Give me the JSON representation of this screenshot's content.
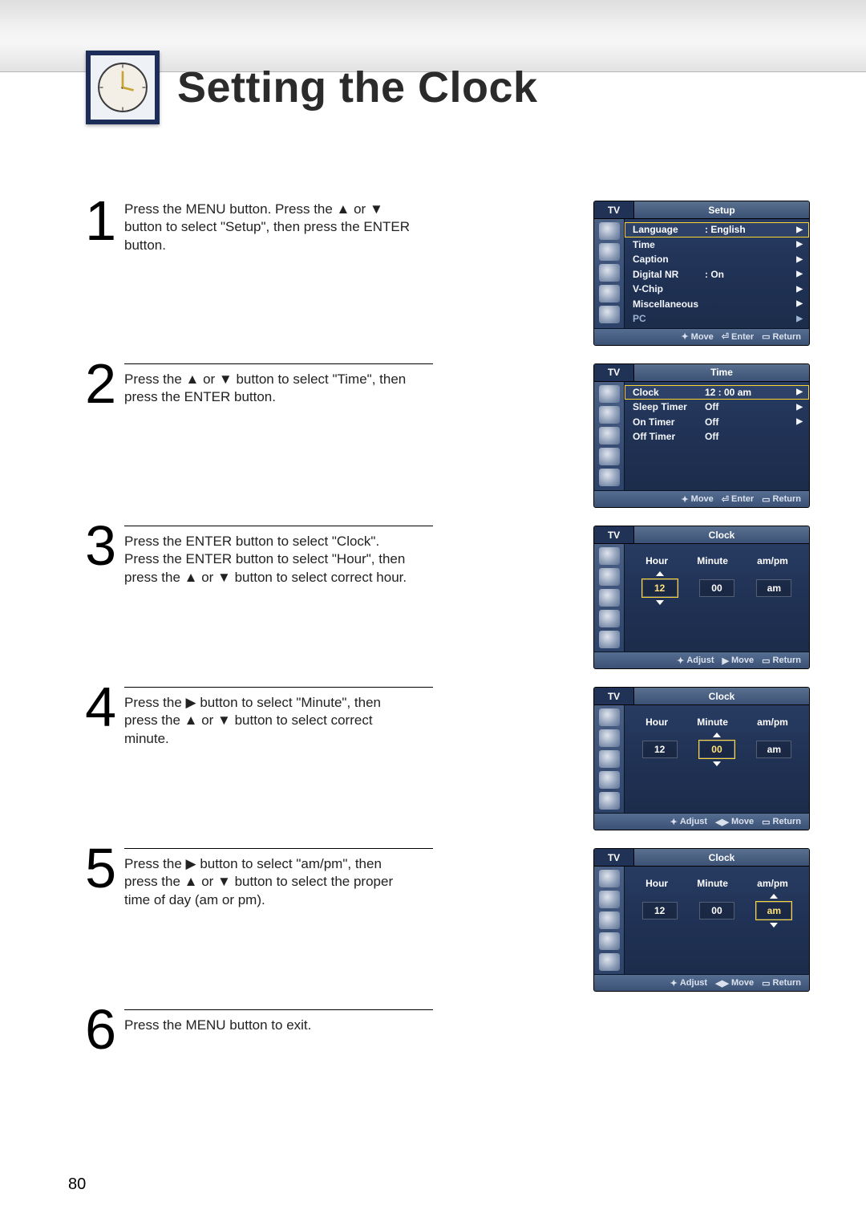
{
  "header": {
    "title": "Setting the Clock"
  },
  "page_number": "80",
  "glyph": {
    "up": "▲",
    "down": "▼",
    "right": "▶",
    "left": "◀",
    "updown": "◆",
    "leftright": "◀▶",
    "enter_box": "⏎",
    "return_box": "▭"
  },
  "steps": [
    {
      "num": "1",
      "text": "Press the MENU button. Press the ▲ or ▼ button to select \"Setup\", then press the ENTER button."
    },
    {
      "num": "2",
      "text": "Press the ▲ or ▼ button to select \"Time\", then press the ENTER button."
    },
    {
      "num": "3",
      "text": "Press the ENTER button to select \"Clock\". Press the ENTER button to select \"Hour\", then press the ▲ or ▼ button to select correct hour."
    },
    {
      "num": "4",
      "text": "Press the ▶ button to select \"Minute\", then press the ▲ or ▼ button to select correct minute."
    },
    {
      "num": "5",
      "text": "Press the ▶ button to select \"am/pm\", then press the ▲ or ▼ button to select the proper time of day (am or pm)."
    },
    {
      "num": "6",
      "text": "Press the MENU button to exit."
    }
  ],
  "screens": {
    "setup": {
      "tl": "TV",
      "title": "Setup",
      "rows": [
        {
          "label": "Language",
          "val": ": English",
          "arr": "▶",
          "sel": true
        },
        {
          "label": "Time",
          "val": "",
          "arr": "▶"
        },
        {
          "label": "Caption",
          "val": "",
          "arr": "▶"
        },
        {
          "label": "Digital NR",
          "val": ": On",
          "arr": "▶"
        },
        {
          "label": "V-Chip",
          "val": "",
          "arr": "▶"
        },
        {
          "label": "Miscellaneous",
          "val": "",
          "arr": "▶"
        },
        {
          "label": "PC",
          "val": "",
          "arr": "▶",
          "dim": true
        }
      ],
      "hints": [
        {
          "sym": "✦",
          "txt": "Move"
        },
        {
          "sym": "⏎",
          "txt": "Enter"
        },
        {
          "sym": "▭",
          "txt": "Return"
        }
      ]
    },
    "time": {
      "tl": "TV",
      "title": "Time",
      "rows": [
        {
          "label": "Clock",
          "val": "12 : 00 am",
          "arr": "▶",
          "sel": true
        },
        {
          "label": "Sleep Timer",
          "val": "Off",
          "arr": "▶"
        },
        {
          "label": "On Timer",
          "val": "Off",
          "arr": "▶"
        },
        {
          "label": "Off Timer",
          "val": "Off",
          "arr": ""
        }
      ],
      "hints": [
        {
          "sym": "✦",
          "txt": "Move"
        },
        {
          "sym": "⏎",
          "txt": "Enter"
        },
        {
          "sym": "▭",
          "txt": "Return"
        }
      ]
    },
    "clock_hour": {
      "tl": "TV",
      "title": "Clock",
      "hdr": [
        "Hour",
        "Minute",
        "am/pm"
      ],
      "vals": [
        "12",
        "00",
        "am"
      ],
      "selIndex": 0,
      "hints": [
        {
          "sym": "✦",
          "txt": "Adjust"
        },
        {
          "sym": "▶",
          "txt": "Move"
        },
        {
          "sym": "▭",
          "txt": "Return"
        }
      ]
    },
    "clock_min": {
      "tl": "TV",
      "title": "Clock",
      "hdr": [
        "Hour",
        "Minute",
        "am/pm"
      ],
      "vals": [
        "12",
        "00",
        "am"
      ],
      "selIndex": 1,
      "hints": [
        {
          "sym": "✦",
          "txt": "Adjust"
        },
        {
          "sym": "◀▶",
          "txt": "Move"
        },
        {
          "sym": "▭",
          "txt": "Return"
        }
      ]
    },
    "clock_ampm": {
      "tl": "TV",
      "title": "Clock",
      "hdr": [
        "Hour",
        "Minute",
        "am/pm"
      ],
      "vals": [
        "12",
        "00",
        "am"
      ],
      "selIndex": 2,
      "hints": [
        {
          "sym": "✦",
          "txt": "Adjust"
        },
        {
          "sym": "◀▶",
          "txt": "Move"
        },
        {
          "sym": "▭",
          "txt": "Return"
        }
      ]
    }
  }
}
